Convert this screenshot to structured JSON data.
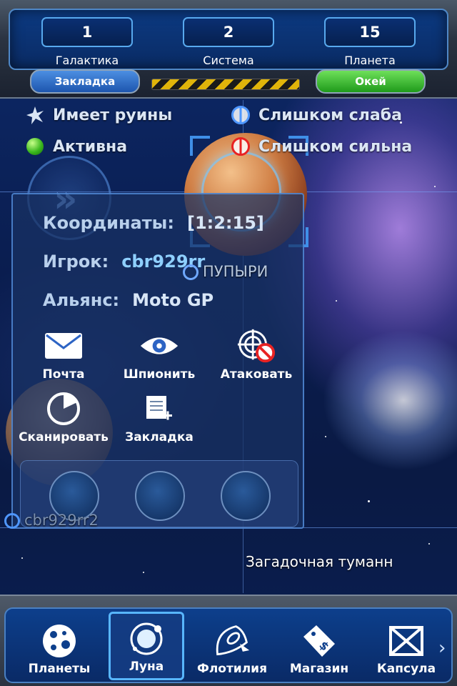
{
  "coordinates_bar": {
    "galaxy": {
      "value": "1",
      "label": "Галактика"
    },
    "system": {
      "value": "2",
      "label": "Система"
    },
    "planet": {
      "value": "15",
      "label": "Планета"
    },
    "bookmark_tab": "Закладка",
    "ok_tab": "Окей"
  },
  "legend": {
    "ruins": "Имеет руины",
    "active": "Активна",
    "too_weak": "Слишком слаба",
    "too_strong": "Слишком сильна"
  },
  "map": {
    "planet_owner_label": "ПУПЫРИ",
    "moon_owner_label": "cbr929rr2",
    "nebula_label": "Загадочная туманн"
  },
  "info_panel": {
    "coordinates_label": "Координаты:",
    "coordinates_value": "[1:2:15]",
    "player_label": "Игрок:",
    "player_value": "cbr929rr",
    "alliance_label": "Альянс:",
    "alliance_value": "Moto GP",
    "actions": {
      "mail": "Почта",
      "spy": "Шпионить",
      "attack": "Атаковать",
      "scan": "Сканировать",
      "bookmark": "Закладка"
    }
  },
  "bottom_nav": {
    "items": [
      {
        "label": "Планеты",
        "icon": "planet-icon"
      },
      {
        "label": "Луна",
        "icon": "moon-orbit-icon",
        "active": true
      },
      {
        "label": "Флотилия",
        "icon": "rocket-icon"
      },
      {
        "label": "Магазин",
        "icon": "price-tag-icon"
      },
      {
        "label": "Капсула",
        "icon": "crate-icon"
      }
    ]
  },
  "colors": {
    "accent": "#3f8fe8",
    "ok_green": "#2aa823",
    "bookmark_blue": "#2b6fcc",
    "attack_red": "#e82323"
  }
}
